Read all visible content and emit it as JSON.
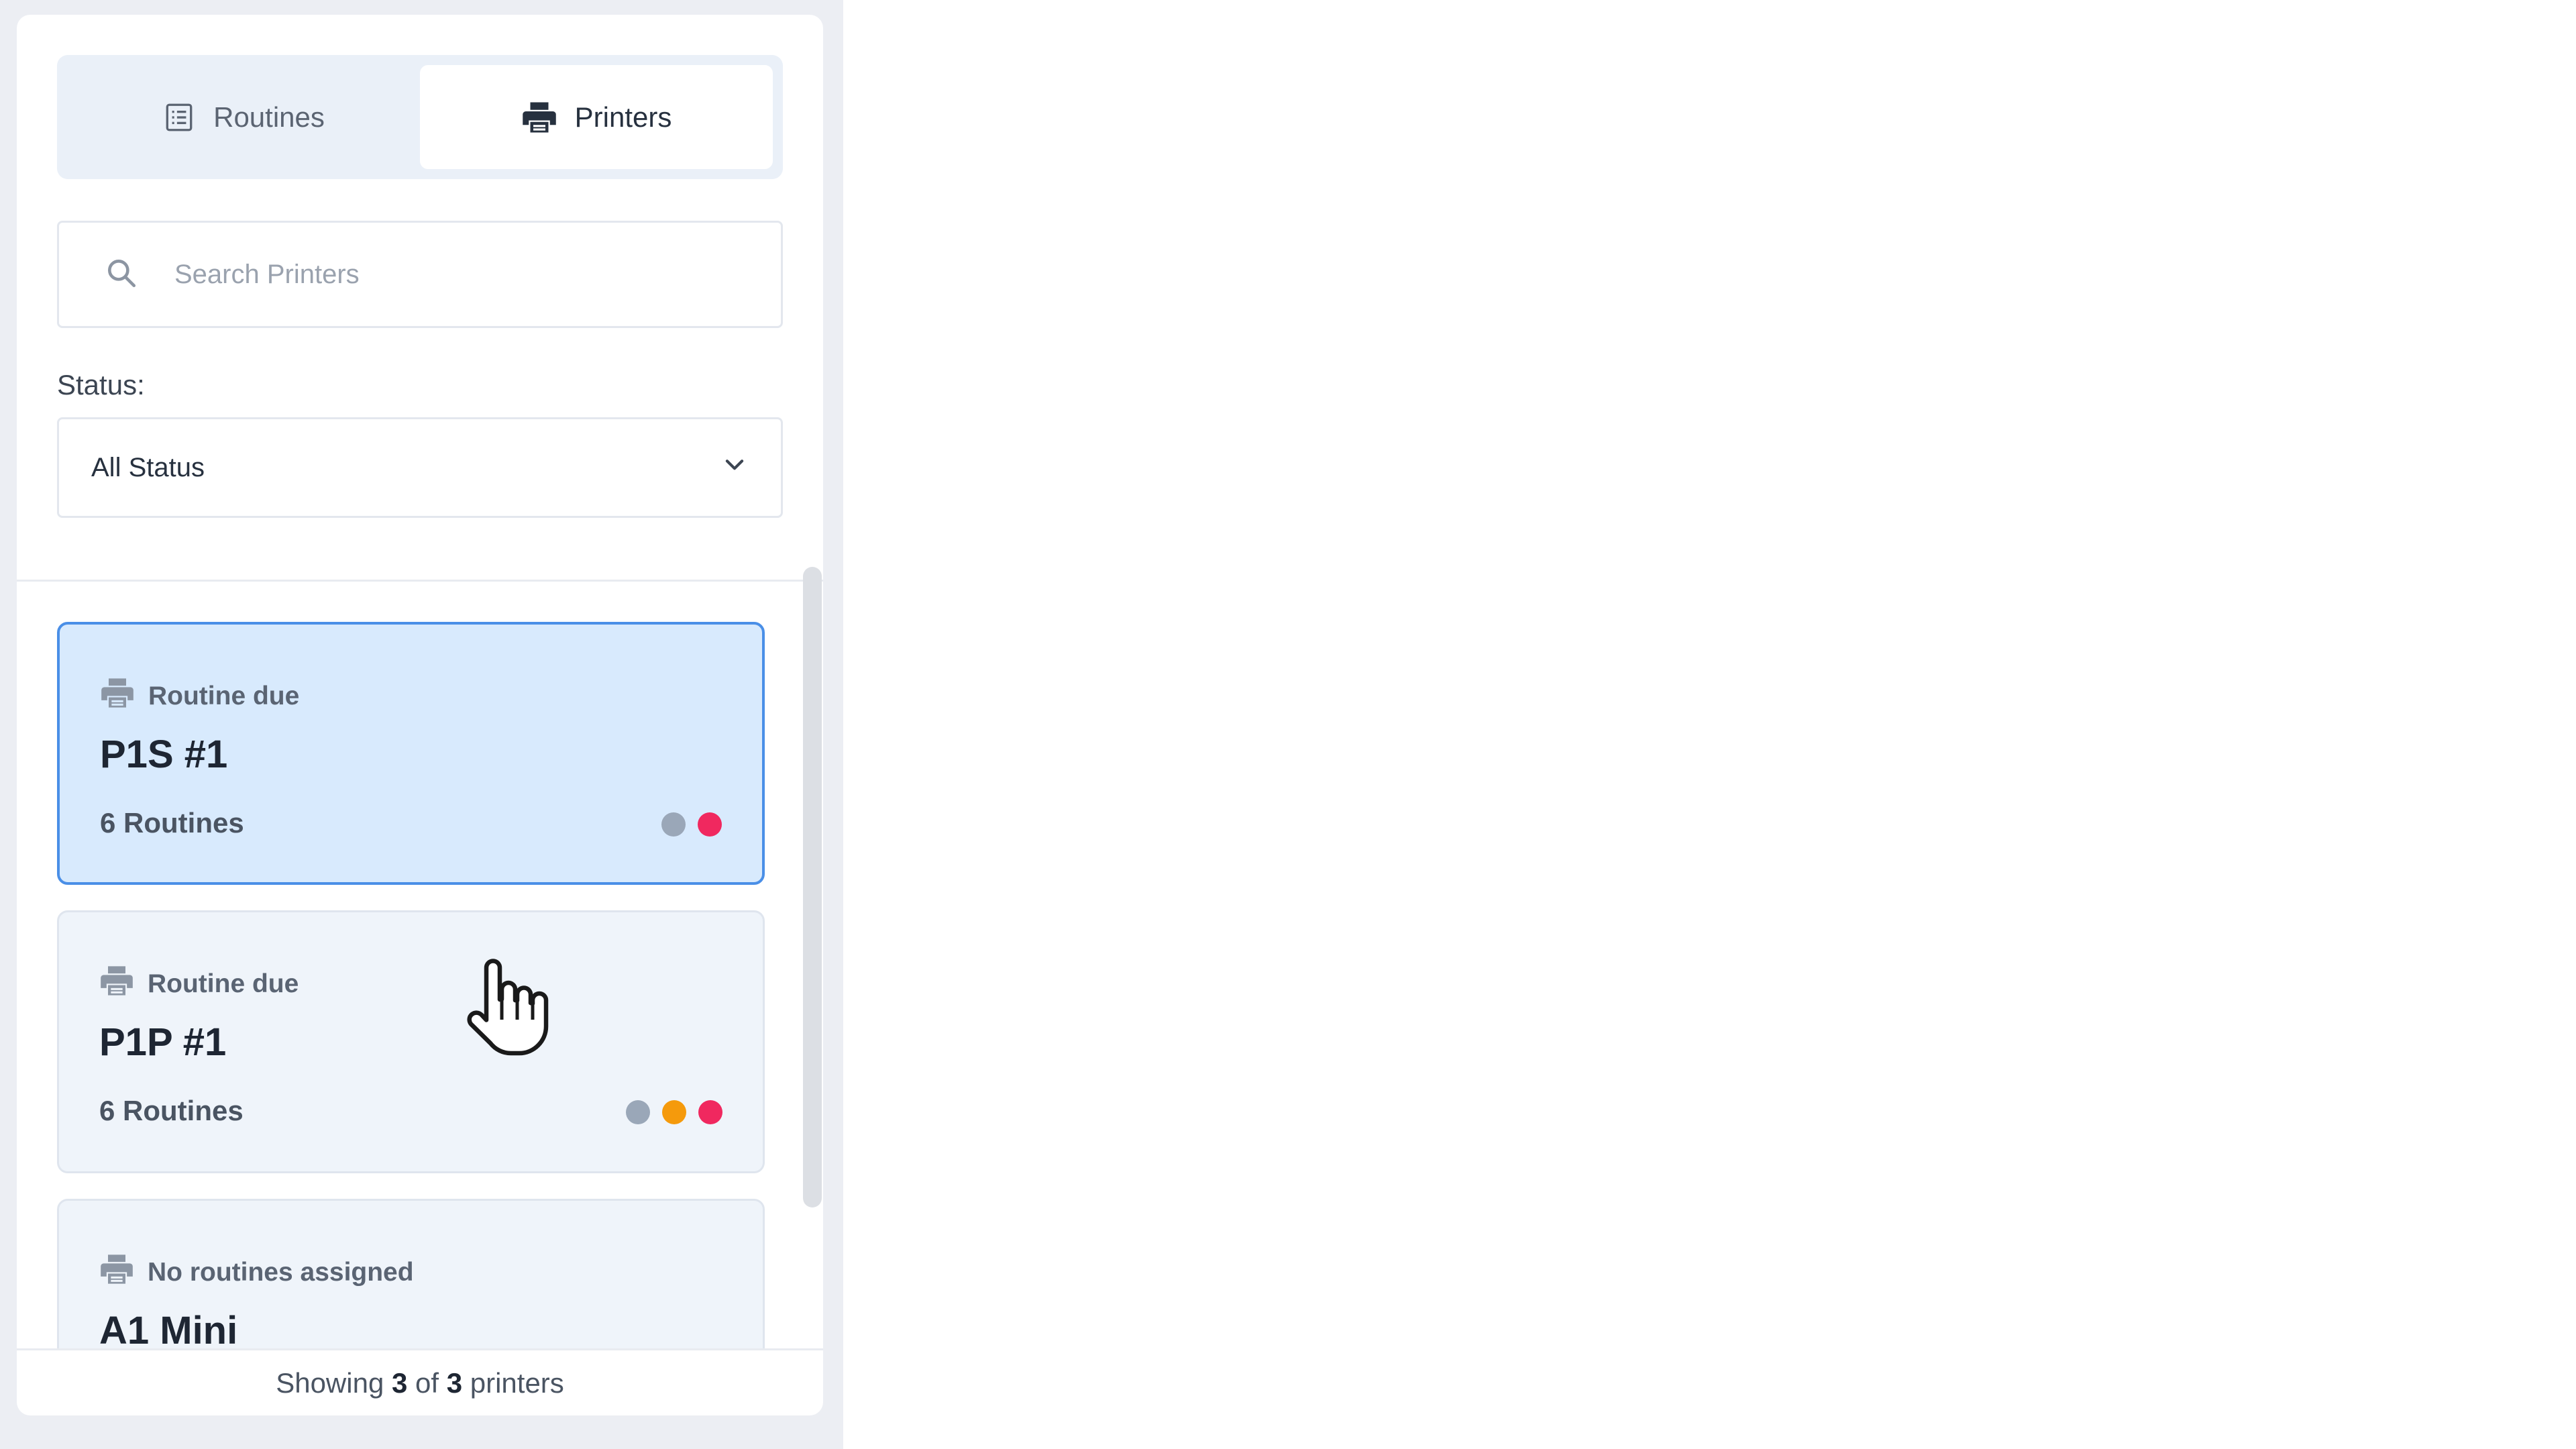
{
  "tabs": [
    {
      "label": "Routines",
      "icon": "list-icon",
      "active": false
    },
    {
      "label": "Printers",
      "icon": "printer-icon",
      "active": true
    }
  ],
  "search": {
    "placeholder": "Search Printers",
    "value": ""
  },
  "status_filter": {
    "label": "Status:",
    "selected": "All Status"
  },
  "printers": [
    {
      "status": "Routine due",
      "name": "P1S #1",
      "routines": "6 Routines",
      "dots": [
        "#9aa7b8",
        "#f0285f"
      ],
      "selected": true
    },
    {
      "status": "Routine due",
      "name": "P1P #1",
      "routines": "6 Routines",
      "dots": [
        "#9aa7b8",
        "#f59a0c",
        "#f0285f"
      ],
      "selected": false
    },
    {
      "status": "No routines assigned",
      "name": "A1 Mini",
      "routines": "",
      "dots": [],
      "selected": false
    }
  ],
  "footer": {
    "prefix": "Showing ",
    "shown": "3",
    "middle": " of ",
    "total": "3",
    "suffix": " printers"
  },
  "colors": {
    "accent": "#4a8fe7",
    "selected_bg": "#d8eafd",
    "card_bg": "#eff4fa"
  }
}
